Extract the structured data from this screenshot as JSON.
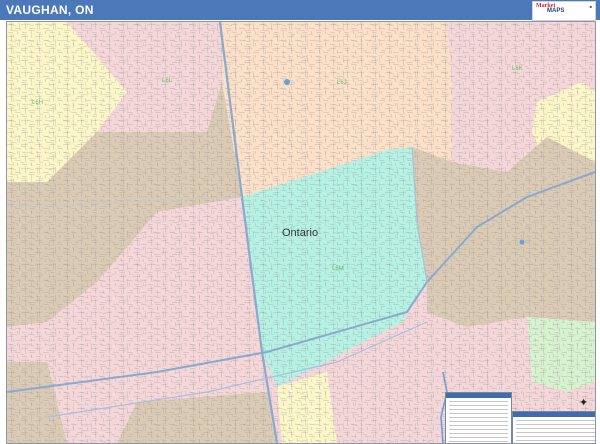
{
  "header": {
    "title": "VAUGHAN, ON"
  },
  "map": {
    "region_label": "Ontario",
    "zip_labels": [
      "L6J",
      "L6L",
      "L6H",
      "L6K",
      "L6M"
    ],
    "zone_colors": {
      "pink": "#f6d7d9",
      "peach": "#fce0c8",
      "tan": "#dccbb4",
      "cyan": "#b6f2e4",
      "yellow": "#fdf6c8",
      "green": "#d7f2cf"
    },
    "water_color": "#6aa0d8",
    "road_color": "#8aa9d0"
  },
  "logo": {
    "brand_top": "Market",
    "brand_main": "MAPS"
  },
  "icons": {
    "north_arrow": "north-arrow-icon"
  }
}
